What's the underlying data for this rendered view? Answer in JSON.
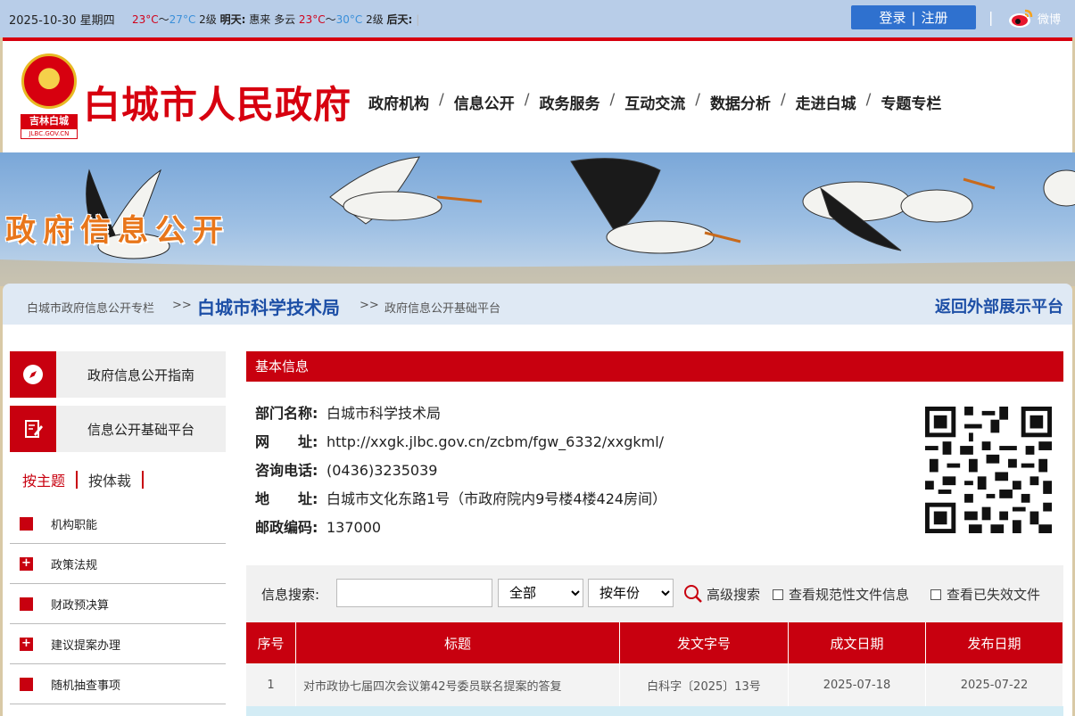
{
  "topbar": {
    "date": "2025-10-30 星期四",
    "today": {
      "low": "23°C",
      "tilde": "～",
      "high": "27°C",
      "wind": "2级"
    },
    "tomorrow": {
      "label": "明天:",
      "desc": "惠来 多云",
      "low": "23°C",
      "tilde": "～",
      "high": "30°C",
      "wind": "2级"
    },
    "aftertomorrow": {
      "label": "后天:",
      "sep": "|"
    },
    "login": "登录",
    "divider": "|",
    "register": "注册",
    "bar": "|",
    "weibo": "微博"
  },
  "header": {
    "emblem_tag": "吉林白城",
    "emblem_domain": "JLBC.GOV.CN",
    "site_title": "白城市人民政府",
    "nav": [
      "政府机构",
      "信息公开",
      "政务服务",
      "互动交流",
      "数据分析",
      "走进白城",
      "专题专栏"
    ],
    "nav_sep": "/"
  },
  "banner": {
    "title": "政府信息公开"
  },
  "breadcrumb": {
    "level1": "白城市政府信息公开专栏",
    "arrow": ">>",
    "level2": "白城市科学技术局",
    "level3": "政府信息公开基础平台",
    "back": "返回外部展示平台"
  },
  "sidebar": {
    "buttons": [
      {
        "label": "政府信息公开指南",
        "icon": "compass-icon"
      },
      {
        "label": "信息公开基础平台",
        "icon": "edit-document-icon"
      }
    ],
    "tabs": [
      "按主题",
      "按体裁"
    ],
    "items": [
      {
        "label": "机构职能",
        "mark": ""
      },
      {
        "label": "政策法规",
        "mark": "+"
      },
      {
        "label": "财政预决算",
        "mark": ""
      },
      {
        "label": "建议提案办理",
        "mark": "+"
      },
      {
        "label": "随机抽查事项",
        "mark": ""
      }
    ]
  },
  "basic": {
    "heading": "基本信息",
    "fields": [
      {
        "key": "部门名称:",
        "value": "白城市科学技术局"
      },
      {
        "key": "网　　址:",
        "value": "http://xxgk.jlbc.gov.cn/zcbm/fgw_6332/xxgkml/"
      },
      {
        "key": "咨询电话:",
        "value": "(0436)3235039"
      },
      {
        "key": "地　　址:",
        "value": "白城市文化东路1号（市政府院内9号楼4楼424房间）"
      },
      {
        "key": "邮政编码:",
        "value": "137000"
      }
    ]
  },
  "search": {
    "label": "信息搜索:",
    "keyword": "",
    "scope_selected": "全部",
    "year_selected": "按年份",
    "advanced": "高级搜索",
    "check1": "查看规范性文件信息",
    "check2": "查看已失效文件"
  },
  "table": {
    "headers": [
      "序号",
      "标题",
      "发文字号",
      "成文日期",
      "发布日期"
    ],
    "rows": [
      [
        "1",
        "对市政协七届四次会议第42号委员联名提案的答复",
        "白科字〔2025〕13号",
        "2025-07-18",
        "2025-07-22"
      ]
    ]
  },
  "colors": {
    "brand_red": "#c8000f",
    "link_blue": "#1d4fa6",
    "topbar_blue": "#b8cde8"
  }
}
